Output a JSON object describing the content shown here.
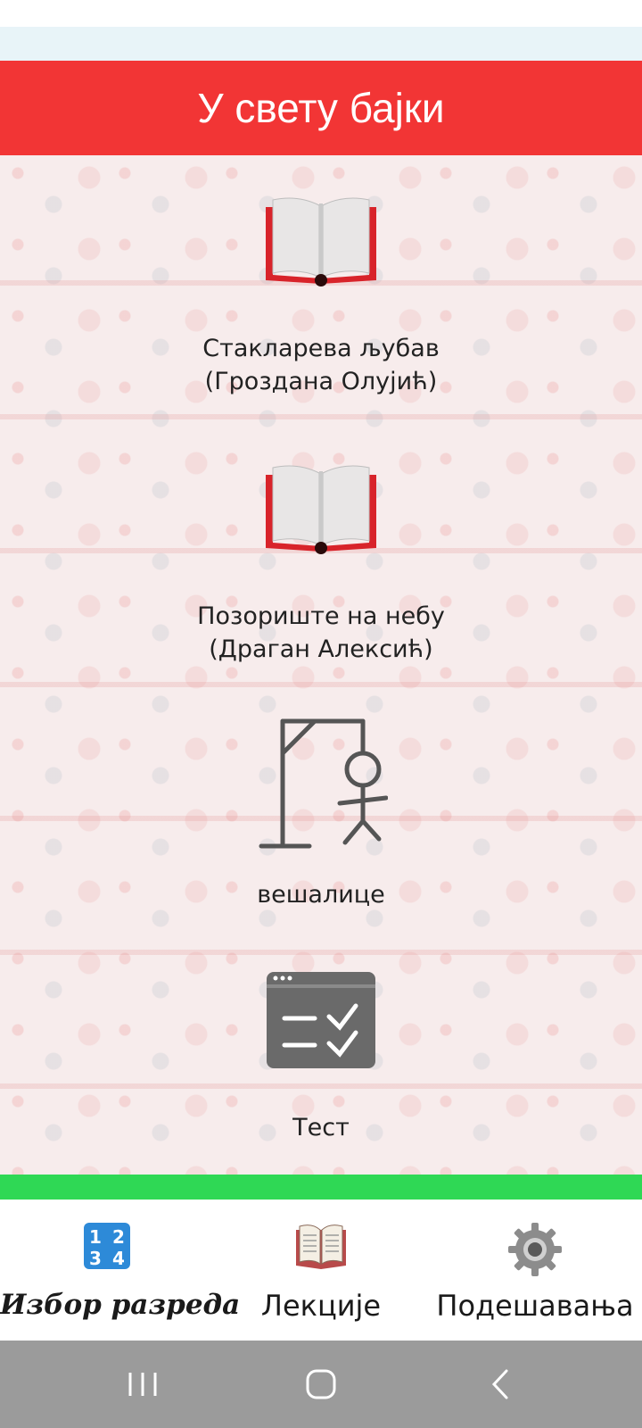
{
  "app": {
    "title": "У свету бајки"
  },
  "menu": {
    "items": [
      {
        "label": "Стакларева љубав\n (Гроздана Олујић)",
        "icon": "open-book-icon"
      },
      {
        "label": "Позориште на небу\n (Драган Алексић)",
        "icon": "open-book-icon"
      },
      {
        "label": "вешалице",
        "icon": "hangman-icon"
      },
      {
        "label": "Тест",
        "icon": "quiz-checklist-icon"
      }
    ]
  },
  "bottom_nav": {
    "items": [
      {
        "label": "Избор разреда",
        "icon": "numbers-keypad-icon",
        "selected": true
      },
      {
        "label": "Лекције",
        "icon": "book-icon",
        "selected": false
      },
      {
        "label": "Подешавања",
        "icon": "gear-icon",
        "selected": false
      }
    ]
  },
  "colors": {
    "header": "#f23535",
    "accent_bar": "#2fd855",
    "system_nav": "#9b9b9b"
  }
}
